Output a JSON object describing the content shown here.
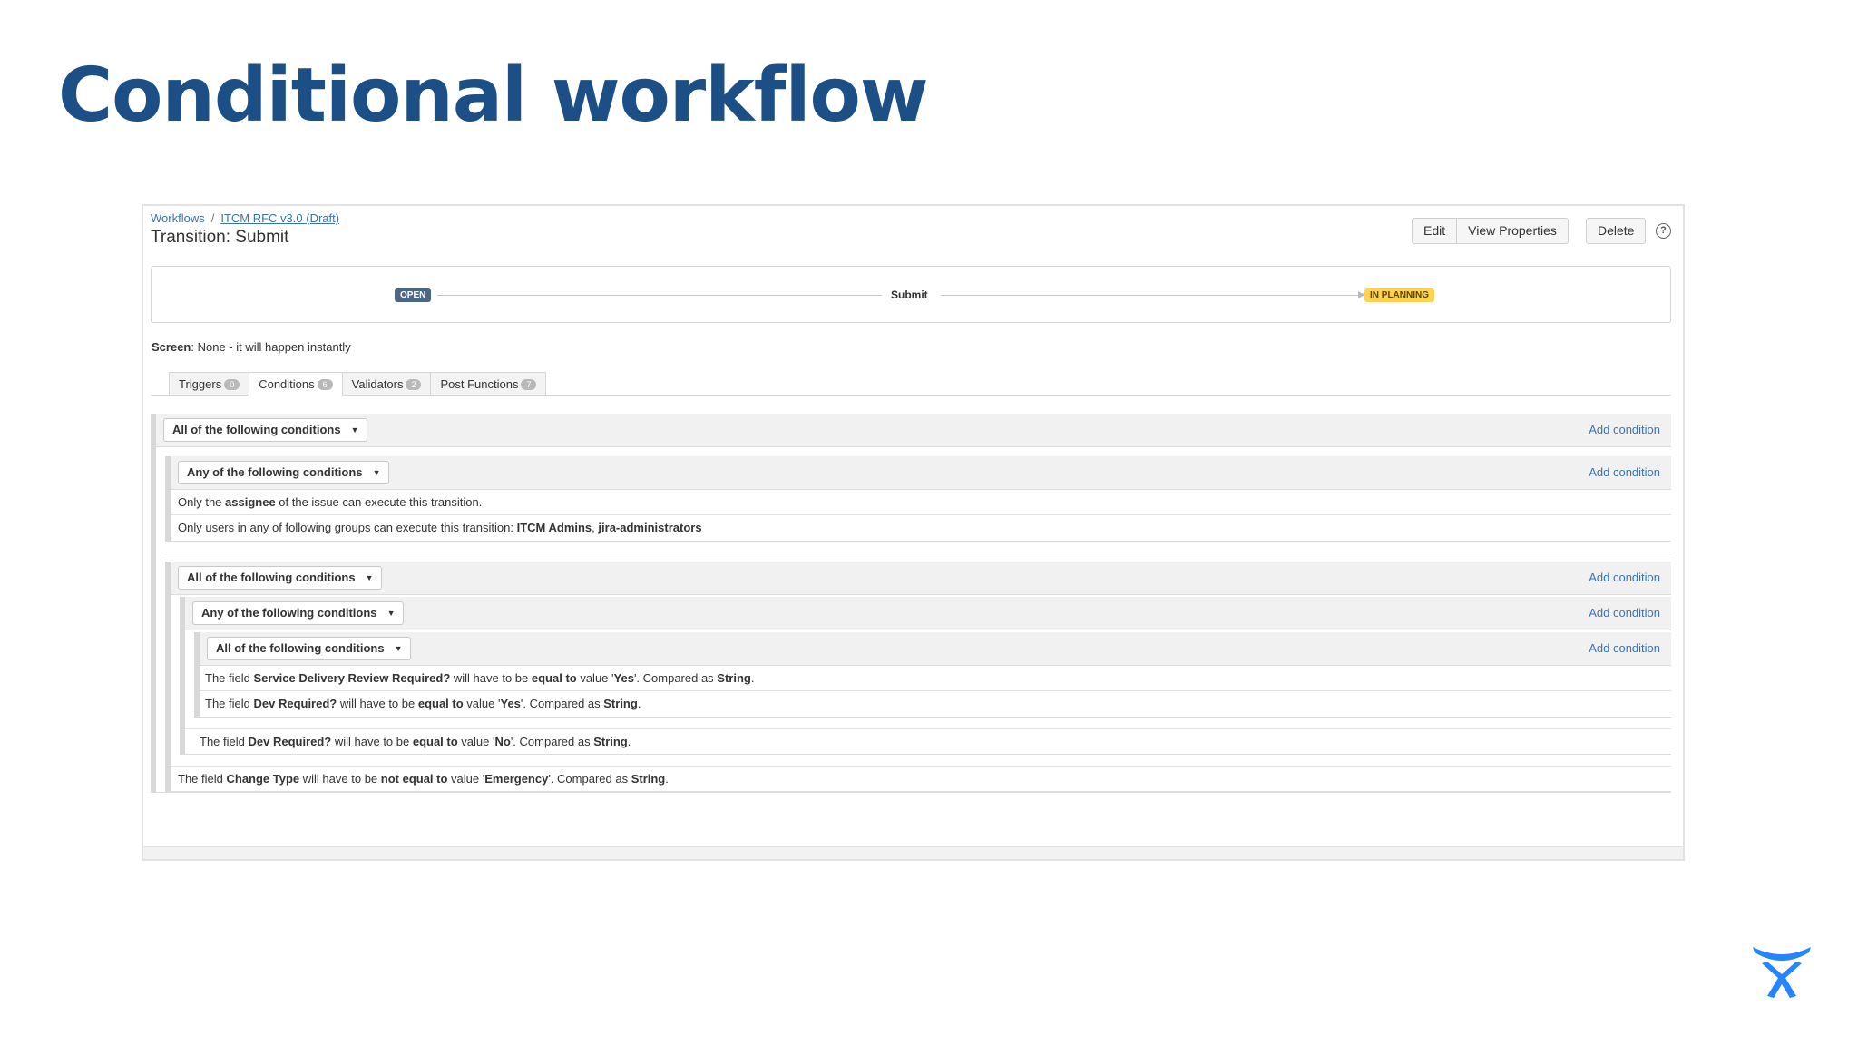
{
  "slide": {
    "title": "Conditional workflow"
  },
  "breadcrumb": {
    "root": "Workflows",
    "separator": "/",
    "current": "ITCM RFC v3.0 (Draft)"
  },
  "page_title": "Transition: Submit",
  "toolbar": {
    "edit": "Edit",
    "view_properties": "View Properties",
    "delete": "Delete",
    "help": "?"
  },
  "diagram": {
    "from_status": "OPEN",
    "transition": "Submit",
    "to_status": "IN PLANNING"
  },
  "screen": {
    "label": "Screen",
    "value": ": None - it will happen instantly"
  },
  "tabs": [
    {
      "label": "Triggers",
      "count": "0"
    },
    {
      "label": "Conditions",
      "count": "6"
    },
    {
      "label": "Validators",
      "count": "2"
    },
    {
      "label": "Post Functions",
      "count": "7"
    }
  ],
  "conditions": {
    "add_label": "Add condition",
    "root_select": "All of the following conditions",
    "group1_select": "Any of the following conditions",
    "g1_row1": {
      "a": "Only the ",
      "b": "assignee",
      "c": " of the issue can execute this transition."
    },
    "g1_row2": {
      "a": "Only users in any of following groups can execute this transition: ",
      "b": "ITCM Admins",
      "c": ", ",
      "d": "jira-administrators"
    },
    "group2_select": "All of the following conditions",
    "group3_select": "Any of the following conditions",
    "group4_select": "All of the following conditions",
    "g4_row1": {
      "a": "The field ",
      "b": "Service Delivery Review Required?",
      "c": " will have to be ",
      "d": "equal to",
      "e": " value '",
      "f": "Yes",
      "g": "'. Compared as ",
      "h": "String",
      "i": "."
    },
    "g4_row2": {
      "a": "The field ",
      "b": "Dev Required?",
      "c": " will have to be ",
      "d": "equal to",
      "e": " value '",
      "f": "Yes",
      "g": "'. Compared as ",
      "h": "String",
      "i": "."
    },
    "g3_row": {
      "a": "The field ",
      "b": "Dev Required?",
      "c": " will have to be ",
      "d": "equal to",
      "e": " value '",
      "f": "No",
      "g": "'. Compared as ",
      "h": "String",
      "i": "."
    },
    "g2_row": {
      "a": "The field ",
      "b": "Change Type",
      "c": " will have to be ",
      "d": "not equal to",
      "e": " value '",
      "f": "Emergency",
      "g": "'. Compared as ",
      "h": "String",
      "i": "."
    }
  },
  "colors": {
    "title": "#1c4f86",
    "link": "#3b73af",
    "open_lozenge": "#4a6785",
    "planning_lozenge": "#ffd351",
    "logo": "#2684ff"
  },
  "logo_icon": "atlassian-logo-icon"
}
